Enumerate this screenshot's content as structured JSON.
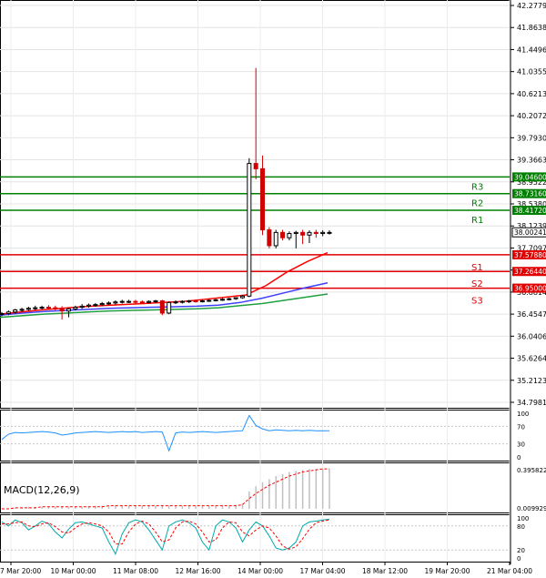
{
  "chart_data": [
    {
      "type": "candlestick",
      "name": "price",
      "y_ticks": [
        "42.27795",
        "41.86380",
        "41.44965",
        "41.03550",
        "40.62135",
        "40.20720",
        "39.79305",
        "39.36635",
        "38.95220",
        "38.53805",
        "38.12390",
        "37.70975",
        "37.29560",
        "36.88145",
        "36.45475",
        "36.04060",
        "35.62645",
        "35.21230",
        "34.79815"
      ],
      "ylim": [
        34.79815,
        42.27795
      ],
      "current_price": "38.00241",
      "levels": [
        {
          "label": "R3",
          "value": 39.046,
          "text": "39.04600",
          "color": "#008000"
        },
        {
          "label": "R2",
          "value": 38.7316,
          "text": "38.73160",
          "color": "#008000"
        },
        {
          "label": "R1",
          "value": 38.4172,
          "text": "38.41720",
          "color": "#008000"
        },
        {
          "label": "S1",
          "value": 37.5788,
          "text": "37.57880",
          "color": "#e00000"
        },
        {
          "label": "S2",
          "value": 37.2644,
          "text": "37.26440",
          "color": "#e00000"
        },
        {
          "label": "S3",
          "value": 36.95,
          "text": "36.95000",
          "color": "#e00000"
        }
      ],
      "candles_xrange": [
        0,
        360
      ],
      "candles": [
        {
          "o": 36.46,
          "h": 36.5,
          "l": 36.42,
          "c": 36.47
        },
        {
          "o": 36.47,
          "h": 36.53,
          "l": 36.44,
          "c": 36.5
        },
        {
          "o": 36.5,
          "h": 36.56,
          "l": 36.47,
          "c": 36.54
        },
        {
          "o": 36.54,
          "h": 36.58,
          "l": 36.5,
          "c": 36.55
        },
        {
          "o": 36.55,
          "h": 36.6,
          "l": 36.52,
          "c": 36.57
        },
        {
          "o": 36.57,
          "h": 36.62,
          "l": 36.54,
          "c": 36.58
        },
        {
          "o": 36.58,
          "h": 36.62,
          "l": 36.55,
          "c": 36.59
        },
        {
          "o": 36.59,
          "h": 36.63,
          "l": 36.55,
          "c": 36.58
        },
        {
          "o": 36.58,
          "h": 36.62,
          "l": 36.53,
          "c": 36.56
        },
        {
          "o": 36.56,
          "h": 36.61,
          "l": 36.36,
          "c": 36.52
        },
        {
          "o": 36.52,
          "h": 36.58,
          "l": 36.4,
          "c": 36.56
        },
        {
          "o": 36.56,
          "h": 36.62,
          "l": 36.53,
          "c": 36.59
        },
        {
          "o": 36.59,
          "h": 36.65,
          "l": 36.56,
          "c": 36.61
        },
        {
          "o": 36.61,
          "h": 36.66,
          "l": 36.58,
          "c": 36.63
        },
        {
          "o": 36.63,
          "h": 36.67,
          "l": 36.6,
          "c": 36.64
        },
        {
          "o": 36.64,
          "h": 36.69,
          "l": 36.61,
          "c": 36.66
        },
        {
          "o": 36.66,
          "h": 36.7,
          "l": 36.63,
          "c": 36.67
        },
        {
          "o": 36.67,
          "h": 36.72,
          "l": 36.64,
          "c": 36.69
        },
        {
          "o": 36.69,
          "h": 36.73,
          "l": 36.66,
          "c": 36.7
        },
        {
          "o": 36.7,
          "h": 36.73,
          "l": 36.67,
          "c": 36.7
        },
        {
          "o": 36.7,
          "h": 36.73,
          "l": 36.66,
          "c": 36.69
        },
        {
          "o": 36.69,
          "h": 36.72,
          "l": 36.66,
          "c": 36.68
        },
        {
          "o": 36.68,
          "h": 36.72,
          "l": 36.66,
          "c": 36.7
        },
        {
          "o": 36.7,
          "h": 36.73,
          "l": 36.67,
          "c": 36.71
        },
        {
          "o": 36.71,
          "h": 36.73,
          "l": 36.44,
          "c": 36.48
        },
        {
          "o": 36.48,
          "h": 36.7,
          "l": 36.46,
          "c": 36.68
        },
        {
          "o": 36.68,
          "h": 36.72,
          "l": 36.65,
          "c": 36.69
        },
        {
          "o": 36.69,
          "h": 36.72,
          "l": 36.66,
          "c": 36.7
        },
        {
          "o": 36.7,
          "h": 36.73,
          "l": 36.67,
          "c": 36.71
        },
        {
          "o": 36.71,
          "h": 36.73,
          "l": 36.68,
          "c": 36.7
        },
        {
          "o": 36.7,
          "h": 36.73,
          "l": 36.68,
          "c": 36.71
        },
        {
          "o": 36.71,
          "h": 36.74,
          "l": 36.69,
          "c": 36.72
        },
        {
          "o": 36.72,
          "h": 36.75,
          "l": 36.7,
          "c": 36.73
        },
        {
          "o": 36.73,
          "h": 36.76,
          "l": 36.71,
          "c": 36.74
        },
        {
          "o": 36.74,
          "h": 36.77,
          "l": 36.72,
          "c": 36.75
        },
        {
          "o": 36.75,
          "h": 36.78,
          "l": 36.73,
          "c": 36.77
        },
        {
          "o": 36.77,
          "h": 36.82,
          "l": 36.75,
          "c": 36.8
        },
        {
          "o": 36.8,
          "h": 39.4,
          "l": 36.78,
          "c": 39.3
        },
        {
          "o": 39.3,
          "h": 41.1,
          "l": 39.0,
          "c": 39.2
        },
        {
          "o": 39.2,
          "h": 39.45,
          "l": 37.95,
          "c": 38.05
        },
        {
          "o": 38.05,
          "h": 38.1,
          "l": 37.7,
          "c": 37.75
        },
        {
          "o": 37.75,
          "h": 38.05,
          "l": 37.7,
          "c": 38.0
        },
        {
          "o": 38.0,
          "h": 38.05,
          "l": 37.85,
          "c": 37.9
        },
        {
          "o": 37.9,
          "h": 38.02,
          "l": 37.85,
          "c": 37.98
        },
        {
          "o": 37.98,
          "h": 38.03,
          "l": 37.7,
          "c": 38.0
        },
        {
          "o": 38.0,
          "h": 38.05,
          "l": 37.78,
          "c": 37.95
        },
        {
          "o": 37.95,
          "h": 38.04,
          "l": 37.8,
          "c": 38.0
        },
        {
          "o": 38.0,
          "h": 38.05,
          "l": 37.9,
          "c": 37.98
        },
        {
          "o": 37.98,
          "h": 38.04,
          "l": 37.93,
          "c": 38.0
        },
        {
          "o": 38.0,
          "h": 38.04,
          "l": 37.96,
          "c": 38.0
        }
      ],
      "ma_red": [
        36.46,
        36.5,
        36.54,
        36.57,
        36.6,
        36.62,
        36.64,
        36.66,
        36.68,
        36.7,
        36.74,
        36.78,
        36.82,
        37.0,
        37.25,
        37.45,
        37.62
      ],
      "ma_blue": [
        36.44,
        36.48,
        36.51,
        36.53,
        36.55,
        36.57,
        36.58,
        36.59,
        36.6,
        36.61,
        36.63,
        36.68,
        36.76,
        36.86,
        36.96,
        37.05
      ],
      "ma_green": [
        36.4,
        36.43,
        36.46,
        36.48,
        36.5,
        36.52,
        36.53,
        36.54,
        36.55,
        36.56,
        36.58,
        36.62,
        36.66,
        36.72,
        36.78,
        36.84
      ]
    },
    {
      "type": "line",
      "name": "RSI",
      "y_ticks": [
        "100",
        "70",
        "30",
        "0"
      ],
      "ylim": [
        0,
        100
      ],
      "values": [
        40,
        52,
        56,
        55,
        56,
        57,
        58,
        57,
        55,
        50,
        52,
        55,
        56,
        57,
        58,
        57,
        56,
        57,
        58,
        57,
        58,
        56,
        57,
        58,
        57,
        14,
        55,
        57,
        56,
        57,
        58,
        57,
        56,
        57,
        58,
        59,
        60,
        95,
        72,
        64,
        60,
        62,
        61,
        60,
        61,
        60,
        61,
        60,
        60,
        60
      ]
    },
    {
      "type": "bar",
      "name": "MACD",
      "title": "MACD(12,26,9)",
      "y_ticks": [
        "0.395822",
        "0.009929"
      ],
      "ylim": [
        0,
        0.4
      ],
      "values": [
        0.0,
        0.0,
        0.01,
        0.01,
        0.02,
        0.02,
        0.02,
        0.02,
        0.02,
        0.02,
        0.02,
        0.02,
        0.02,
        0.02,
        0.03,
        0.03,
        0.03,
        0.03,
        0.03,
        0.03,
        0.03,
        0.03,
        0.03,
        0.03,
        0.03,
        0.03,
        0.03,
        0.03,
        0.03,
        0.03,
        0.03,
        0.03,
        0.03,
        0.03,
        0.03,
        0.04,
        0.05,
        0.17,
        0.22,
        0.26,
        0.29,
        0.32,
        0.34,
        0.36,
        0.37,
        0.38,
        0.39,
        0.39,
        0.39,
        0.39
      ],
      "signal": [
        0.0,
        0.0,
        0.01,
        0.01,
        0.01,
        0.01,
        0.02,
        0.02,
        0.02,
        0.02,
        0.02,
        0.02,
        0.02,
        0.02,
        0.02,
        0.02,
        0.03,
        0.03,
        0.03,
        0.03,
        0.03,
        0.03,
        0.03,
        0.03,
        0.03,
        0.03,
        0.03,
        0.03,
        0.03,
        0.03,
        0.03,
        0.03,
        0.03,
        0.03,
        0.03,
        0.03,
        0.04,
        0.1,
        0.15,
        0.19,
        0.23,
        0.26,
        0.29,
        0.32,
        0.34,
        0.36,
        0.37,
        0.38,
        0.39,
        0.39
      ]
    },
    {
      "type": "line",
      "name": "Stochastic",
      "y_ticks": [
        "100",
        "80",
        "20",
        "0"
      ],
      "ylim": [
        0,
        100
      ],
      "k": [
        90,
        80,
        95,
        88,
        70,
        80,
        92,
        85,
        65,
        50,
        72,
        88,
        90,
        85,
        80,
        75,
        40,
        10,
        60,
        88,
        95,
        90,
        70,
        45,
        20,
        80,
        90,
        95,
        88,
        75,
        40,
        20,
        80,
        95,
        90,
        75,
        40,
        70,
        90,
        80,
        55,
        25,
        20,
        25,
        40,
        80,
        90,
        92,
        95,
        97
      ],
      "d": [
        85,
        85,
        88,
        90,
        80,
        78,
        85,
        88,
        78,
        65,
        62,
        75,
        85,
        88,
        85,
        80,
        65,
        35,
        35,
        65,
        85,
        92,
        85,
        65,
        40,
        45,
        75,
        90,
        92,
        85,
        65,
        40,
        45,
        75,
        90,
        88,
        65,
        55,
        70,
        80,
        75,
        55,
        30,
        22,
        28,
        48,
        72,
        88,
        92,
        95
      ]
    }
  ],
  "x_ticks": [
    "7 Mar 20:00",
    "10 Mar 00:00",
    "11 Mar 08:00",
    "12 Mar 16:00",
    "14 Mar 00:00",
    "17 Mar 04:00",
    "18 Mar 12:00",
    "19 Mar 20:00",
    "21 Mar 04:00"
  ],
  "colors": {
    "up": "#000000",
    "down": "#d00000",
    "green_level": "#008000",
    "red_level": "#e00000",
    "ma_red": "#ff0000",
    "ma_blue": "#4040ff",
    "ma_green": "#20a040",
    "rsi": "#1e90ff",
    "macd_hist": "#c0c0c0",
    "macd_signal": "#ff0000",
    "stoch_k": "#00aaaa",
    "stoch_d": "#ff0000"
  }
}
